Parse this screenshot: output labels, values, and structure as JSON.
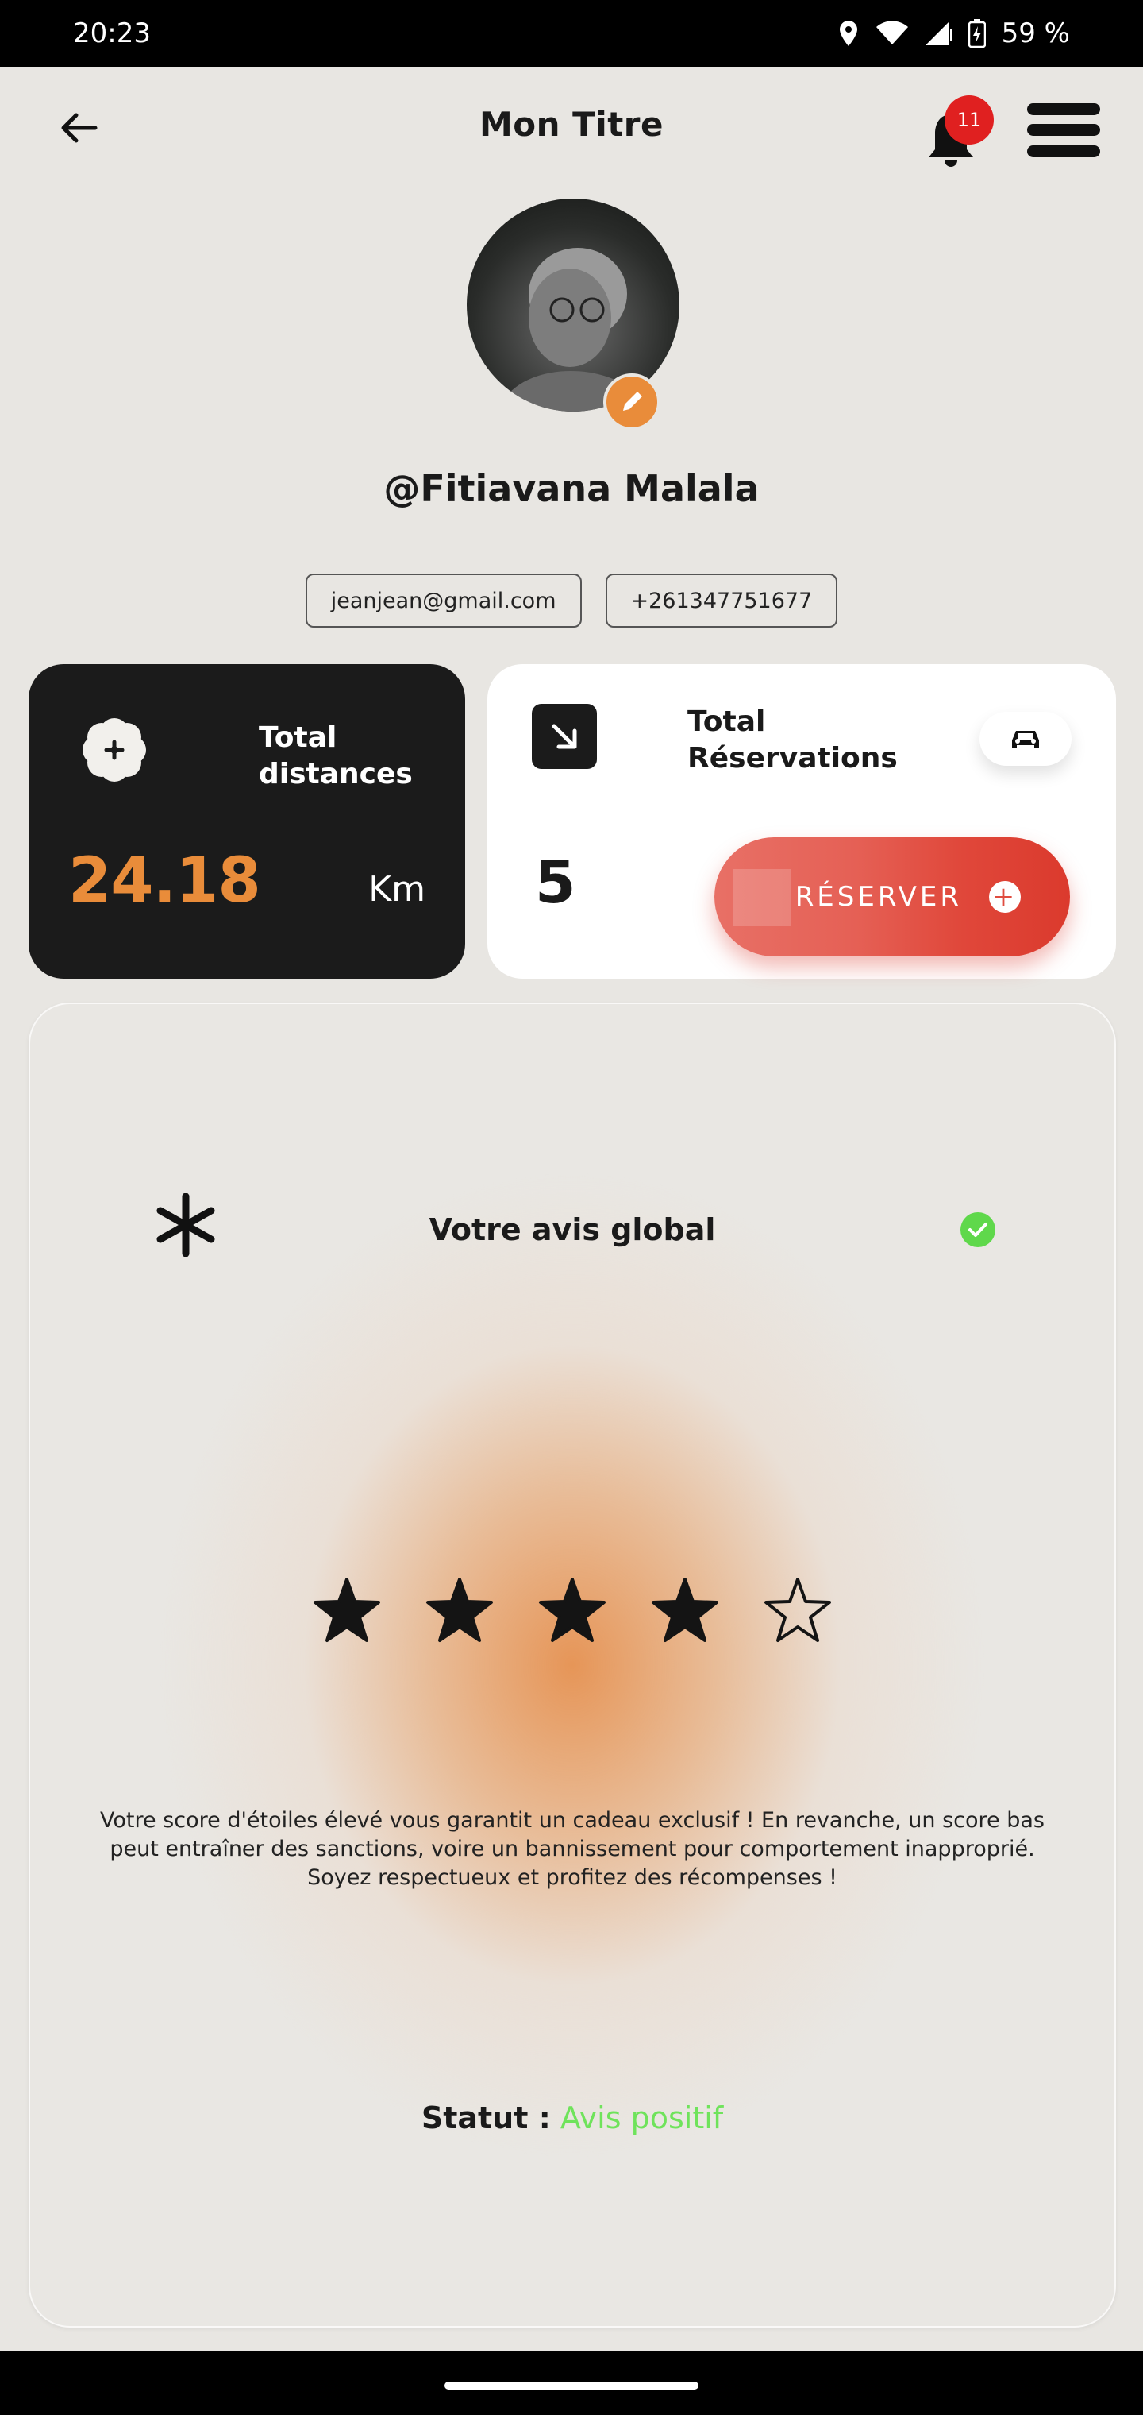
{
  "status_bar": {
    "time": "20:23",
    "battery": "59 %"
  },
  "header": {
    "title": "Mon Titre",
    "notification_count": "11"
  },
  "profile": {
    "username": "@Fitiavana Malala",
    "email": "jeanjean@gmail.com",
    "phone": "+261347751677"
  },
  "distance_card": {
    "label": "Total distances",
    "value": "24.18",
    "unit": "Km"
  },
  "reservation_card": {
    "label": "Total Réservations",
    "value": "5",
    "button_label": "RÉSERVER"
  },
  "review": {
    "heading": "Votre avis global",
    "rating": 4,
    "max_rating": 5,
    "description": "Votre score d'étoiles élevé vous garantit un cadeau exclusif ! En revanche, un score bas peut entraîner des sanctions, voire un bannissement pour comportement inapproprié. Soyez respectueux et profitez des récompenses !",
    "status_label": "Statut :",
    "status_value": "Avis positif"
  },
  "colors": {
    "accent_orange": "#e98c3a",
    "reserve_red": "#e0473a",
    "positive_green": "#6fe35b",
    "card_dark": "#1b1b1b",
    "background": "#e8e6e2"
  },
  "icons": {
    "back": "arrow-left-icon",
    "bell": "bell-icon",
    "menu": "hamburger-menu-icon",
    "edit": "pencil-icon",
    "distance": "flower-plus-icon",
    "reservations": "arrow-down-right-icon",
    "car": "car-icon",
    "reserve_add": "plus-circle-icon",
    "review": "asterisk-icon",
    "status_ok": "check-circle-icon"
  }
}
